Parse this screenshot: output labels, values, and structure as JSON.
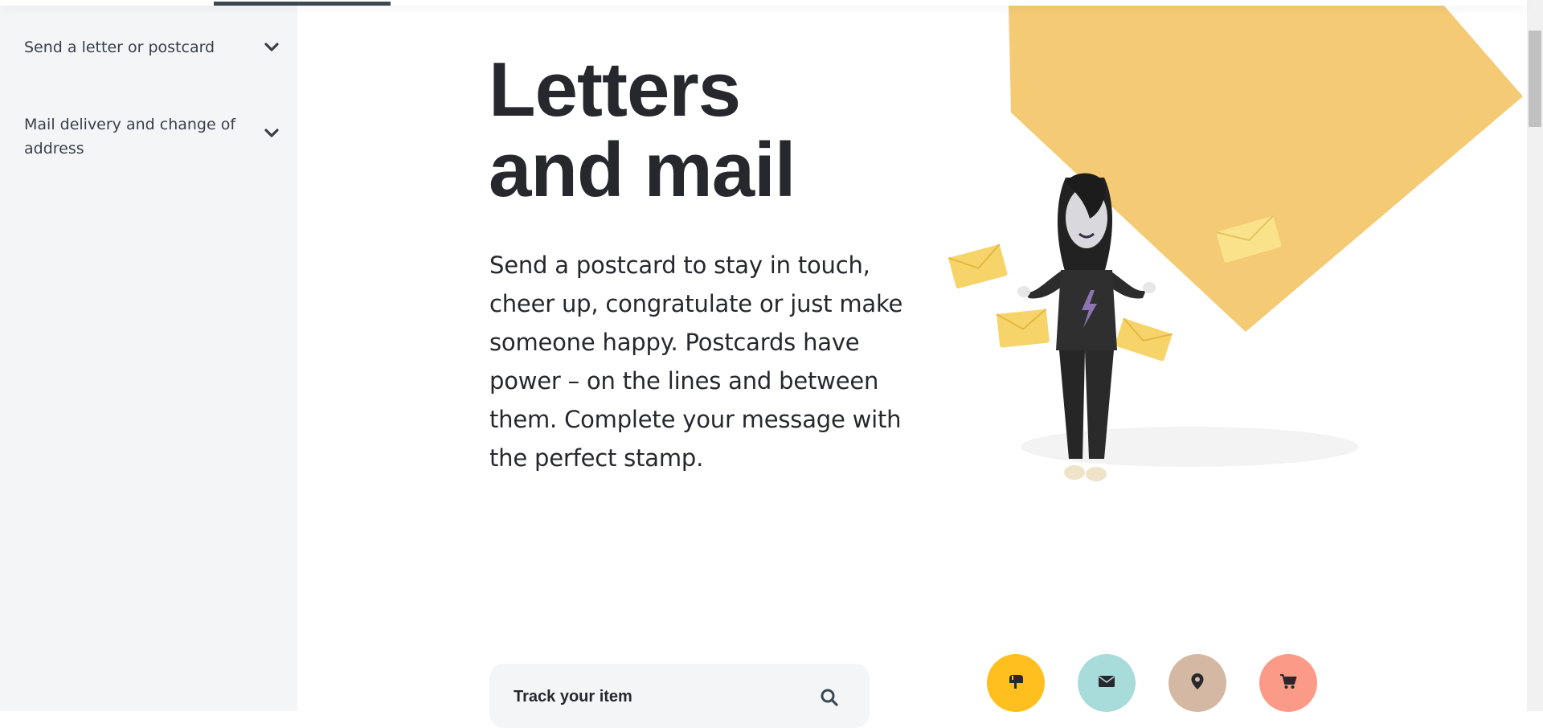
{
  "sidebar": {
    "items": [
      {
        "label": "Send a letter or postcard"
      },
      {
        "label": "Mail delivery and change of address"
      }
    ]
  },
  "hero": {
    "title_line1": "Letters",
    "title_line2": "and mail",
    "description": "Send a postcard to stay in touch, cheer up, congratulate or just make someone happy. Postcards have power – on the lines and between them. Complete your message with the perfect stamp."
  },
  "track": {
    "label": "Track your item",
    "icon": "search-icon"
  },
  "quick_links": [
    {
      "icon": "mailbox-icon",
      "color": "#ffbf1f"
    },
    {
      "icon": "envelope-icon",
      "color": "#a8dcdb"
    },
    {
      "icon": "location-pin-icon",
      "color": "#d5b8a4"
    },
    {
      "icon": "cart-icon",
      "color": "#fb9b87"
    }
  ],
  "colors": {
    "accent_yellow": "#f5ca75",
    "text": "#27282d",
    "sidebar_bg": "#f3f5f7"
  }
}
